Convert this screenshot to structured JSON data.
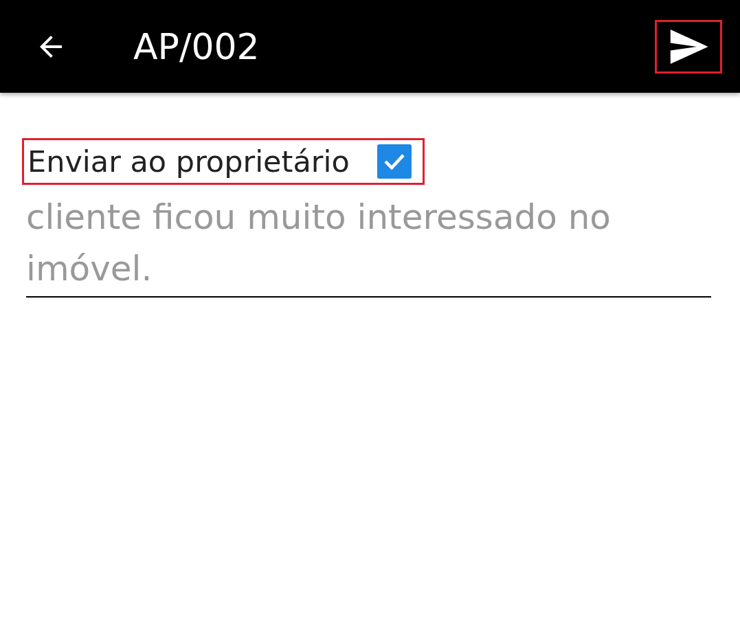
{
  "app_bar": {
    "title": "AP/002",
    "send_button": {
      "highlighted": true
    }
  },
  "send_to_owner": {
    "label": "Enviar ao proprietário",
    "checked": true,
    "highlighted": true
  },
  "note_field": {
    "value": "cliente ficou muito interessado no imóvel.",
    "disabled": true
  }
}
